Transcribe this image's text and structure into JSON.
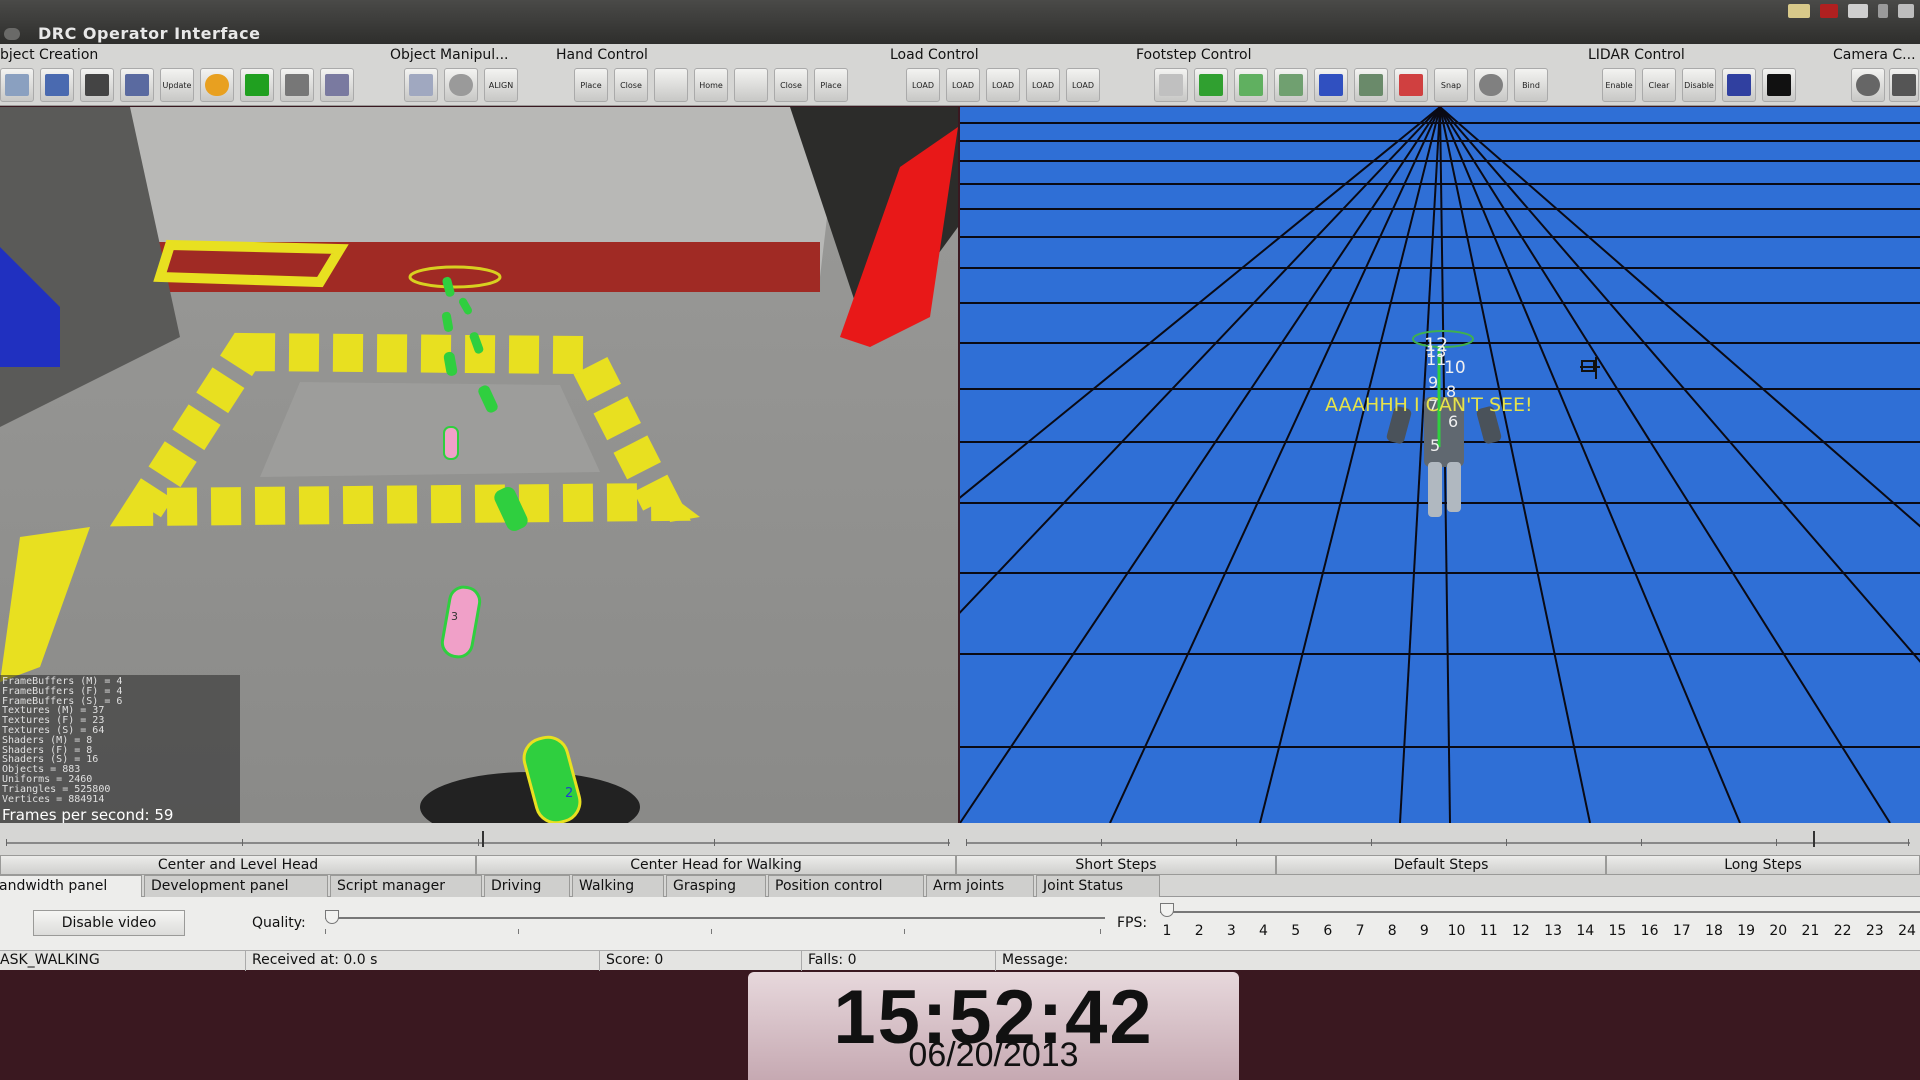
{
  "window": {
    "title": "DRC Operator Interface"
  },
  "toolbar": {
    "groups": [
      {
        "label": "bject Creation"
      },
      {
        "label": "Object Manipul..."
      },
      {
        "label": "Hand Control"
      },
      {
        "label": "Load Control"
      },
      {
        "label": "Footstep Control"
      },
      {
        "label": "LIDAR Control"
      },
      {
        "label": "Camera C..."
      }
    ],
    "button_texts": {
      "update": "Update",
      "align": "ALIGN",
      "place": "Place",
      "close": "Close",
      "home": "Home",
      "load": "LOAD",
      "snap": "Snap",
      "bind": "Bind",
      "enable": "Enable",
      "clear": "Clear",
      "disable": "Disable"
    }
  },
  "left_view": {
    "stats": [
      "FrameBuffers (M) = 4",
      "FrameBuffers (F) = 4",
      "FrameBuffers (S) = 6",
      "Textures (M) = 37",
      "Textures (F) = 23",
      "Textures (S) = 64",
      "Shaders (M) = 8",
      "Shaders (F) = 8",
      "Shaders (S) = 16",
      "Objects = 883",
      "Uniforms = 2460",
      "Triangles = 525800",
      "Vertices = 884914"
    ],
    "fps_text": "Frames per second: 59",
    "footstep_labels": [
      "3",
      "2"
    ]
  },
  "right_view": {
    "warning": "AAAHHH I CAN'T SEE!",
    "step_numbers": [
      "12",
      "13",
      "11",
      "10",
      "9",
      "8",
      "7",
      "6",
      "5"
    ]
  },
  "walk_buttons": [
    {
      "label": "Center and Level Head"
    },
    {
      "label": "Center Head for Walking"
    },
    {
      "label": "Short Steps"
    },
    {
      "label": "Default Steps"
    },
    {
      "label": "Long Steps"
    }
  ],
  "tabs": [
    {
      "label": "andwidth panel",
      "active": true
    },
    {
      "label": "Development panel"
    },
    {
      "label": "Script manager"
    },
    {
      "label": "Driving"
    },
    {
      "label": "Walking"
    },
    {
      "label": "Grasping"
    },
    {
      "label": "Position control"
    },
    {
      "label": "Arm joints"
    },
    {
      "label": "Joint Status"
    }
  ],
  "video_panel": {
    "disable_video_label": "Disable video",
    "quality_label": "Quality:",
    "fps_label": "FPS:",
    "fps_ticks": [
      "1",
      "2",
      "3",
      "4",
      "5",
      "6",
      "7",
      "8",
      "9",
      "10",
      "11",
      "12",
      "13",
      "14",
      "15",
      "16",
      "17",
      "18",
      "19",
      "20",
      "21",
      "22",
      "23",
      "24"
    ]
  },
  "status": {
    "task": "ASK_WALKING",
    "received": "Received at:  0.0 s",
    "score": "Score:  0",
    "falls": "Falls:  0",
    "message": "Message:"
  },
  "clock": {
    "time": "15:52:42",
    "date": "06/20/2013"
  },
  "colors": {
    "grid_blue": "#2f6fd6",
    "warning_yellow": "#e6e34a",
    "hazard_yellow": "#e8e020",
    "footstep_green": "#2fcf3f",
    "footstep_pink": "#f0a0c8"
  }
}
